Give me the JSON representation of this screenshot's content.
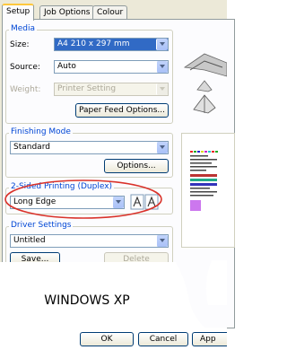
{
  "tabs": [
    {
      "label": "Setup",
      "active": true
    },
    {
      "label": "Job Options",
      "active": false
    },
    {
      "label": "Colour",
      "active": false
    }
  ],
  "media": {
    "legend": "Media",
    "size_label": "Size:",
    "size_value": "A4 210 x 297 mm",
    "source_label": "Source:",
    "source_value": "Auto",
    "weight_label": "Weight:",
    "weight_value": "Printer Setting",
    "paper_feed_button": "Paper Feed Options..."
  },
  "finishing": {
    "legend": "Finishing Mode",
    "value": "Standard",
    "options_button": "Options..."
  },
  "duplex": {
    "legend": "2-Sided Printing (Duplex)",
    "value": "Long Edge",
    "highlight_color": "#d9322a"
  },
  "driver": {
    "legend": "Driver Settings",
    "value": "Untitled",
    "save_button": "Save...",
    "delete_button": "Delete"
  },
  "caption": "WINDOWS XP",
  "footer": {
    "ok": "OK",
    "cancel": "Cancel",
    "apply": "App"
  },
  "colors": {
    "accent": "#0046d5",
    "panel": "#ece9d8",
    "selection": "#316ac5"
  }
}
